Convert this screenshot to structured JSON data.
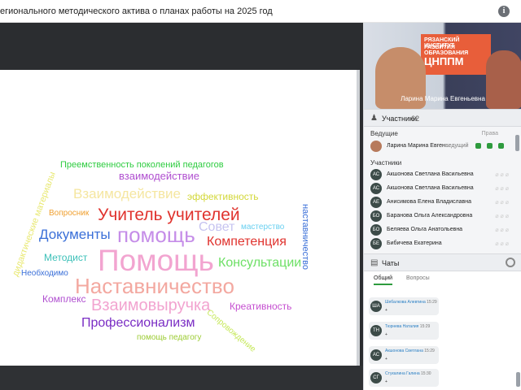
{
  "header": {
    "title": "егионального методического актива о планах работы на 2025 год",
    "info_icon": "info-icon"
  },
  "slide": {
    "words": [
      {
        "text": "Преемственность поколений педагогов",
        "color": "#2ecc40"
      },
      {
        "text": "взаимодействие",
        "color": "#b04fd0"
      },
      {
        "text": "Взаимодействие",
        "color": "#f5e6a0"
      },
      {
        "text": "эффективность",
        "color": "#d3d83a"
      },
      {
        "text": "Вопросник",
        "color": "#f0a030"
      },
      {
        "text": "Учитель учителей",
        "color": "#e0332e"
      },
      {
        "text": "наставничество",
        "color": "#3a6fd8"
      },
      {
        "text": "Совет",
        "color": "#c6c3f0"
      },
      {
        "text": "мастерство",
        "color": "#6ad0f0"
      },
      {
        "text": "Документы",
        "color": "#3a6fd8"
      },
      {
        "text": "помощь",
        "color": "#c58de8"
      },
      {
        "text": "Компетенция",
        "color": "#e0332e"
      },
      {
        "text": "дидактические материалы",
        "color": "#e8e870"
      },
      {
        "text": "Методист",
        "color": "#3cc0b8"
      },
      {
        "text": "Помощь",
        "color": "#f2a4d0"
      },
      {
        "text": "Консультации",
        "color": "#6ee066"
      },
      {
        "text": "Необходимо",
        "color": "#3a6fd8"
      },
      {
        "text": "Наставничество",
        "color": "#f3a8a0"
      },
      {
        "text": "Комплекс",
        "color": "#b04fd0"
      },
      {
        "text": "Взаимовыручка",
        "color": "#f2a4d0"
      },
      {
        "text": "Креативность",
        "color": "#c54fd0"
      },
      {
        "text": "Профессионализм",
        "color": "#7a2dc4"
      },
      {
        "text": "Сопровождение",
        "color": "#c6e85a"
      },
      {
        "text": "помощь педагогу",
        "color": "#9ccc33"
      }
    ]
  },
  "video": {
    "banner_line1": "РЯЗАНСКИЙ ИНСТИТУТ",
    "banner_line2": "РАЗВИТИЯ ОБРАЗОВАНИЯ",
    "banner_logo": "ЦНППМ",
    "speaker_name": "Ларина Марина Евгеньевна"
  },
  "participants": {
    "label": "Участники",
    "count": "62",
    "host_label": "Ведущие",
    "rights_label": "Права",
    "host": {
      "name": "Ларина Марина Евген...",
      "role": "ведущий"
    },
    "members_label": "Участники",
    "members": [
      {
        "initials": "АС",
        "name": "Акшонова Светлана Васильевна"
      },
      {
        "initials": "АС",
        "name": "Акшонова Светлана Васильевна"
      },
      {
        "initials": "АЕ",
        "name": "Анисимова Елена Владиславна"
      },
      {
        "initials": "БО",
        "name": "Баранова Ольга Александровна"
      },
      {
        "initials": "БО",
        "name": "Беляева Ольга Анатольевна"
      },
      {
        "initials": "БЕ",
        "name": "Бибичева Екатерина"
      }
    ]
  },
  "chat": {
    "label": "Чаты",
    "tabs": [
      "Общий",
      "Вопросы"
    ],
    "messages": [
      {
        "initials": "ША",
        "name": "Шебалкова Алевтина",
        "time": "15:29",
        "text": "+"
      },
      {
        "initials": "ТН",
        "name": "Тюрнева Наталия",
        "time": "15:29",
        "text": "+"
      },
      {
        "initials": "АС",
        "name": "Акшонова Светлана",
        "time": "15:29",
        "text": "+"
      },
      {
        "initials": "СГ",
        "name": "Стукалина Галина",
        "time": "15:30",
        "text": "+"
      }
    ]
  }
}
